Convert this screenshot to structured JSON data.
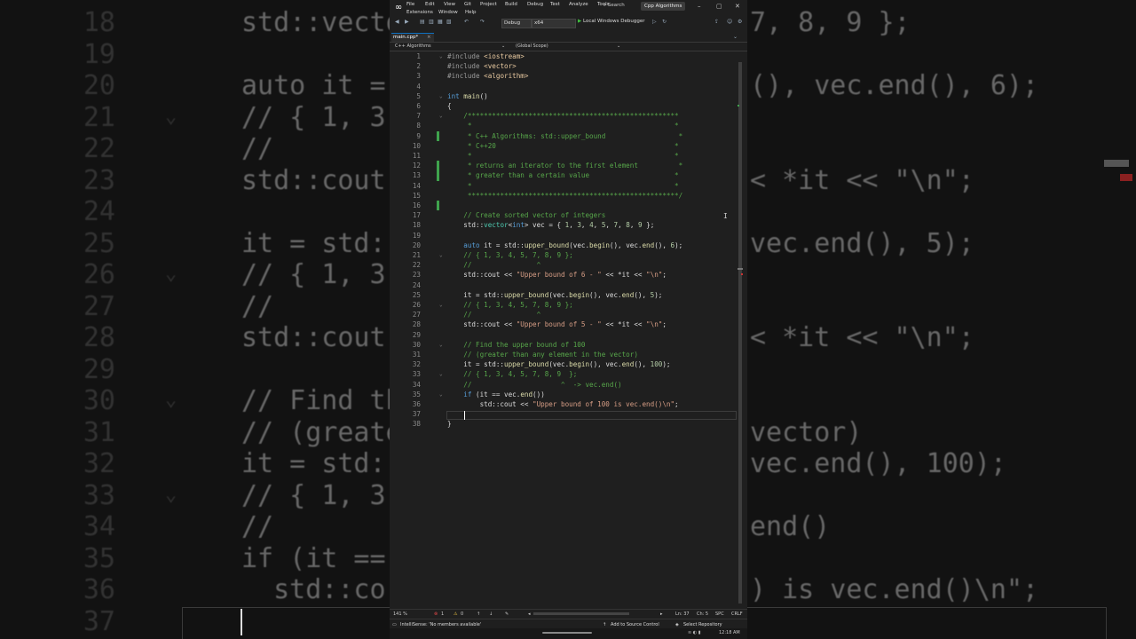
{
  "background": {
    "lines": [
      {
        "n": "18",
        "code": "std::vecto",
        "right": "7, 8, 9 };",
        "fold": ""
      },
      {
        "n": "19",
        "code": "",
        "right": "",
        "fold": ""
      },
      {
        "n": "20",
        "code": "auto it = s",
        "right": "(), vec.end(), 6);",
        "fold": ""
      },
      {
        "n": "21",
        "code": "// { 1, 3,",
        "right": "",
        "fold": "⌄"
      },
      {
        "n": "22",
        "code": "//",
        "right": "",
        "fold": ""
      },
      {
        "n": "23",
        "code": "std::cout <",
        "right": "< *it << \"\\n\";",
        "fold": ""
      },
      {
        "n": "24",
        "code": "",
        "right": "",
        "fold": ""
      },
      {
        "n": "25",
        "code": "it = std::u",
        "right": "vec.end(), 5);",
        "fold": ""
      },
      {
        "n": "26",
        "code": "// { 1, 3,",
        "right": "",
        "fold": "⌄"
      },
      {
        "n": "27",
        "code": "//",
        "right": "",
        "fold": ""
      },
      {
        "n": "28",
        "code": "std::cout <",
        "right": "< *it << \"\\n\";",
        "fold": ""
      },
      {
        "n": "29",
        "code": "",
        "right": "",
        "fold": ""
      },
      {
        "n": "30",
        "code": "// Find the",
        "right": "",
        "fold": "⌄"
      },
      {
        "n": "31",
        "code": "// (greater",
        "right": "vector)",
        "fold": ""
      },
      {
        "n": "32",
        "code": "it = std::u",
        "right": "vec.end(), 100);",
        "fold": ""
      },
      {
        "n": "33",
        "code": "// { 1, 3,",
        "right": "",
        "fold": "⌄"
      },
      {
        "n": "34",
        "code": "//",
        "right": "end()",
        "fold": ""
      },
      {
        "n": "35",
        "code": "if (it == v",
        "right": "",
        "fold": ""
      },
      {
        "n": "36",
        "code": "  std::co",
        "right": ") is vec.end()\\n\";",
        "fold": ""
      },
      {
        "n": "37",
        "code": "",
        "right": "",
        "fold": ""
      }
    ]
  },
  "titlebar": {
    "menu": [
      "File",
      "Edit",
      "View",
      "Git",
      "Project",
      "Build",
      "Debug",
      "Test",
      "Analyze",
      "Tools"
    ],
    "menu_row2": [
      "Extensions",
      "Window",
      "Help"
    ],
    "search": "Search",
    "solution": "Cpp Algorithms"
  },
  "toolbar": {
    "config": "Debug",
    "platform": "x64",
    "run_label": "Local Windows Debugger"
  },
  "tab": {
    "label": "main.cpp*",
    "close": "×"
  },
  "navbar": {
    "project": "C++ Algorithms",
    "scope": "(Global Scope)"
  },
  "editor": {
    "lines": [
      {
        "n": "1",
        "fold": "⌄",
        "html": "<span class='pp'>#include</span> <span class='inc'>&lt;iostream&gt;</span>"
      },
      {
        "n": "2",
        "fold": "",
        "html": "<span class='pp'>#include</span> <span class='inc'>&lt;vector&gt;</span>"
      },
      {
        "n": "3",
        "fold": "",
        "html": "<span class='pp'>#include</span> <span class='inc'>&lt;algorithm&gt;</span>"
      },
      {
        "n": "4",
        "fold": "",
        "html": ""
      },
      {
        "n": "5",
        "fold": "⌄",
        "html": "<span class='kw'>int</span> <span class='fn'>main</span>()"
      },
      {
        "n": "6",
        "fold": "",
        "html": "{"
      },
      {
        "n": "7",
        "fold": "⌄",
        "html": "    <span class='cm'>/****************************************************</span>"
      },
      {
        "n": "8",
        "fold": "",
        "html": "    <span class='cm'> *                                                  *</span>"
      },
      {
        "n": "9",
        "fold": "",
        "html": "    <span class='cm'> * C++ Algorithms: std::upper_bound                  *</span>"
      },
      {
        "n": "10",
        "fold": "",
        "html": "    <span class='cm'> * C++20                                            *</span>"
      },
      {
        "n": "11",
        "fold": "",
        "html": "    <span class='cm'> *                                                  *</span>"
      },
      {
        "n": "12",
        "fold": "",
        "html": "    <span class='cm'> * returns an iterator to the first element          *</span>"
      },
      {
        "n": "13",
        "fold": "",
        "html": "    <span class='cm'> * greater than a certain value                     *</span>"
      },
      {
        "n": "14",
        "fold": "",
        "html": "    <span class='cm'> *                                                  *</span>"
      },
      {
        "n": "15",
        "fold": "",
        "html": "    <span class='cm'> ****************************************************/</span>"
      },
      {
        "n": "16",
        "fold": "",
        "html": ""
      },
      {
        "n": "17",
        "fold": "",
        "html": "    <span class='cm'>// Create sorted vector of integers</span>"
      },
      {
        "n": "18",
        "fold": "",
        "html": "    std::<span class='ty'>vector</span>&lt;<span class='kw'>int</span>&gt; vec = { <span class='num'>1</span>, <span class='num'>3</span>, <span class='num'>4</span>, <span class='num'>5</span>, <span class='num'>7</span>, <span class='num'>8</span>, <span class='num'>9</span> };"
      },
      {
        "n": "19",
        "fold": "",
        "html": ""
      },
      {
        "n": "20",
        "fold": "",
        "html": "    <span class='kw'>auto</span> it = std::<span class='fn'>upper_bound</span>(vec.<span class='fn'>begin</span>(), vec.<span class='fn'>end</span>(), <span class='num'>6</span>);"
      },
      {
        "n": "21",
        "fold": "⌄",
        "html": "    <span class='cm'>// { 1, 3, 4, 5, 7, 8, 9 };</span>"
      },
      {
        "n": "22",
        "fold": "",
        "html": "    <span class='cm'>//                ^</span>"
      },
      {
        "n": "23",
        "fold": "",
        "html": "    std::cout &lt;&lt; <span class='str'>\"Upper bound of 6 - \"</span> &lt;&lt; *it &lt;&lt; <span class='str'>\"\\n\"</span>;"
      },
      {
        "n": "24",
        "fold": "",
        "html": ""
      },
      {
        "n": "25",
        "fold": "",
        "html": "    it = std::<span class='fn'>upper_bound</span>(vec.<span class='fn'>begin</span>(), vec.<span class='fn'>end</span>(), <span class='num'>5</span>);"
      },
      {
        "n": "26",
        "fold": "⌄",
        "html": "    <span class='cm'>// { 1, 3, 4, 5, 7, 8, 9 };</span>"
      },
      {
        "n": "27",
        "fold": "",
        "html": "    <span class='cm'>//                ^</span>"
      },
      {
        "n": "28",
        "fold": "",
        "html": "    std::cout &lt;&lt; <span class='str'>\"Upper bound of 5 - \"</span> &lt;&lt; *it &lt;&lt; <span class='str'>\"\\n\"</span>;"
      },
      {
        "n": "29",
        "fold": "",
        "html": ""
      },
      {
        "n": "30",
        "fold": "⌄",
        "html": "    <span class='cm'>// Find the upper bound of 100</span>"
      },
      {
        "n": "31",
        "fold": "",
        "html": "    <span class='cm'>// (greater than any element in the vector)</span>"
      },
      {
        "n": "32",
        "fold": "",
        "html": "    it = std::<span class='fn'>upper_bound</span>(vec.<span class='fn'>begin</span>(), vec.<span class='fn'>end</span>(), <span class='num'>100</span>);"
      },
      {
        "n": "33",
        "fold": "⌄",
        "html": "    <span class='cm'>// { 1, 3, 4, 5, 7, 8, 9  };</span>"
      },
      {
        "n": "34",
        "fold": "",
        "html": "    <span class='cm'>//                      ^  -> vec.end()</span>"
      },
      {
        "n": "35",
        "fold": "⌄",
        "html": "    <span class='kw'>if</span> (it == vec.<span class='fn'>end</span>())"
      },
      {
        "n": "36",
        "fold": "",
        "html": "        std::cout &lt;&lt; <span class='str'>\"Upper bound of 100 is vec.end()\\n\"</span>;"
      },
      {
        "n": "37",
        "fold": "",
        "html": ""
      },
      {
        "n": "38",
        "fold": "",
        "html": "}"
      }
    ],
    "changed_lines": [
      9,
      12,
      13,
      16
    ]
  },
  "editor_status": {
    "zoom": "141 %",
    "errors": "1",
    "warnings": "0",
    "ln": "Ln: 37",
    "ch": "Ch: 5",
    "spc": "SPC",
    "crlf": "CRLF"
  },
  "statusbar": {
    "intellisense": "IntelliSense: 'No members available'",
    "source_control": "Add to Source Control",
    "repo": "Select Repository",
    "time": "12:18 AM"
  }
}
